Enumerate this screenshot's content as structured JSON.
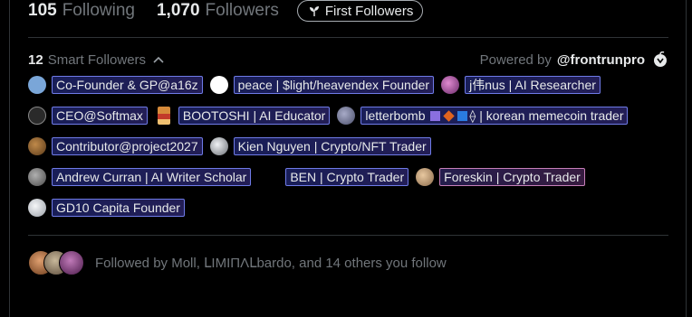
{
  "stats": {
    "following_count": "105",
    "following_label": "Following",
    "followers_count": "1,070",
    "followers_label": "Followers",
    "first_followers_button": "First Followers"
  },
  "smart_followers": {
    "count": "12",
    "label": "Smart Followers",
    "powered_by_label": "Powered by",
    "powered_by_brand": "@frontrunpro",
    "rows": [
      [
        {
          "label": "Co-Founder & GP@a16z",
          "avatar_color": "#7aa6d8"
        },
        {
          "label": "peace | $light/heavendex Founder",
          "avatar_color": "#ffffff"
        },
        {
          "label": "j伟nus | AI Researcher",
          "avatar_color": "#c66ab2"
        }
      ],
      [
        {
          "label": "CEO@Softmax",
          "avatar_color": "#2a2a2a"
        },
        {
          "label": "BOOTOSHI | AI Educator",
          "avatar_color": "#d68a3a"
        },
        {
          "label": "letterbomb",
          "label_suffix": "| korean memecoin trader",
          "avatar_color": "#6b6f8c"
        }
      ],
      [
        {
          "label": "Contributor@project2027",
          "avatar_color": "#8a5a3a"
        },
        {
          "label": "Kien Nguyen | Crypto/NFT Trader",
          "avatar_color": "#cfd3d8"
        }
      ],
      [
        {
          "label": "Andrew Curran | AI Writer Scholar",
          "avatar_color": "#7a7a7a"
        },
        {
          "label": "BEN | Crypto Trader",
          "avatar_color": "#000000"
        },
        {
          "label": "Foreskin | Crypto Trader",
          "avatar_color": "#c8a27a"
        }
      ],
      [
        {
          "label": "GD10 Capita Founder",
          "avatar_color": "#d8dbe0"
        }
      ]
    ]
  },
  "followed_by": {
    "text": "Followed by Moll, ᒪIMIΠΛᒪbardo, and 14 others you follow",
    "avatar_colors": [
      "#b8794a",
      "#9c8a6e",
      "#8c4a8a"
    ]
  },
  "colors": {
    "background": "#000000",
    "chip_border_purple": "#b57cc8",
    "chip_border_blue": "#6f7be8",
    "muted_text": "#71767b"
  }
}
